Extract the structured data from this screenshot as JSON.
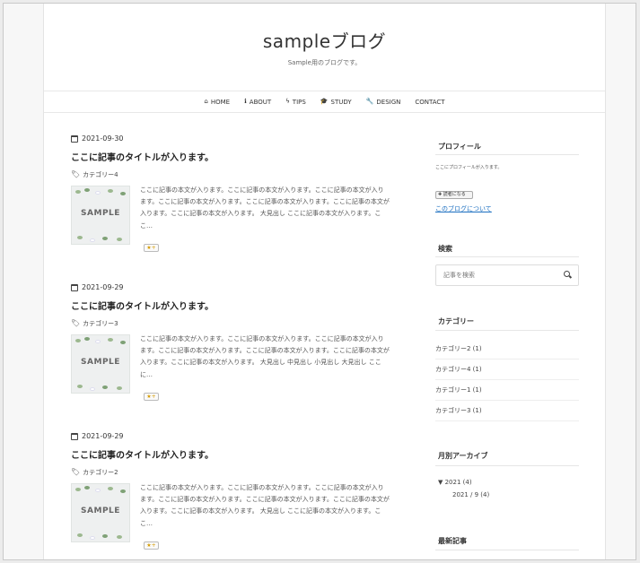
{
  "site": {
    "title": "sampleブログ",
    "description": "Sample用のブログです。"
  },
  "nav": {
    "items": [
      {
        "label": "HOME",
        "icon": "home-icon",
        "glyph": "⌂"
      },
      {
        "label": "ABOUT",
        "icon": "info-icon",
        "glyph": "ℹ"
      },
      {
        "label": "TIPS",
        "icon": "bolt-icon",
        "glyph": "ϟ"
      },
      {
        "label": "STUDY",
        "icon": "graduation-cap-icon",
        "glyph": "🎓"
      },
      {
        "label": "DESIGN",
        "icon": "wrench-icon",
        "glyph": "🔧"
      },
      {
        "label": "CONTACT",
        "icon": "",
        "glyph": ""
      }
    ]
  },
  "posts": [
    {
      "date": "2021-09-30",
      "title": "ここに記事のタイトルが入ります。",
      "category": "カテゴリー4",
      "thumb_label": "SAMPLE",
      "excerpt": "ここに記事の本文が入ります。ここに記事の本文が入ります。ここに記事の本文が入ります。ここに記事の本文が入ります。ここに記事の本文が入ります。ここに記事の本文が入ります。ここに記事の本文が入ります。 大見出し ここに記事の本文が入ります。ここ…",
      "star_label": "★+"
    },
    {
      "date": "2021-09-29",
      "title": "ここに記事のタイトルが入ります。",
      "category": "カテゴリー3",
      "thumb_label": "SAMPLE",
      "excerpt": "ここに記事の本文が入ります。ここに記事の本文が入ります。ここに記事の本文が入ります。ここに記事の本文が入ります。ここに記事の本文が入ります。ここに記事の本文が入ります。ここに記事の本文が入ります。 大見出し 中見出し 小見出し 大見出し ここに…",
      "star_label": "★+"
    },
    {
      "date": "2021-09-29",
      "title": "ここに記事のタイトルが入ります。",
      "category": "カテゴリー2",
      "thumb_label": "SAMPLE",
      "excerpt": "ここに記事の本文が入ります。ここに記事の本文が入ります。ここに記事の本文が入ります。ここに記事の本文が入ります。ここに記事の本文が入ります。ここに記事の本文が入ります。ここに記事の本文が入ります。 大見出し ここに記事の本文が入ります。ここ…",
      "star_label": "★+"
    }
  ],
  "sidebar": {
    "profile": {
      "title": "プロフィール",
      "text": "ここにプロフィールが入ります。",
      "reader_button": "✚ 読者になる",
      "about_link": "このブログについて"
    },
    "search": {
      "title": "検索",
      "placeholder": "記事を検索"
    },
    "categories": {
      "title": "カテゴリー",
      "items": [
        "カテゴリー2 (1)",
        "カテゴリー4 (1)",
        "カテゴリー1 (1)",
        "カテゴリー3 (1)"
      ]
    },
    "archive": {
      "title": "月別アーカイブ",
      "year": "▼ 2021 (4)",
      "month": "2021 / 9 (4)"
    },
    "recent": {
      "title": "最新記事"
    }
  },
  "colors": {
    "link": "#1a6ec0",
    "star": "#d49a00",
    "leaf": "#9cb88f"
  }
}
